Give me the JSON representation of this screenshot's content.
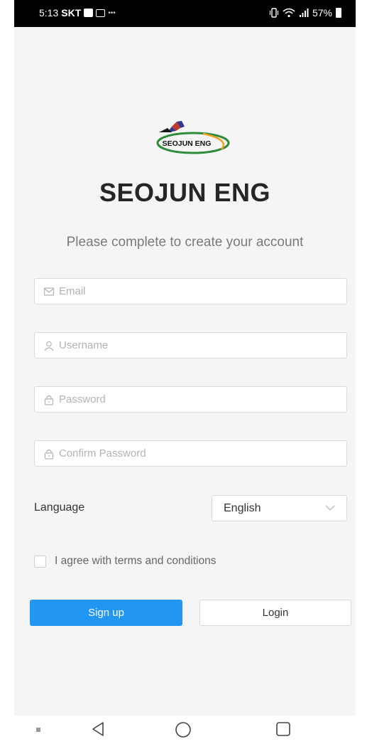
{
  "status_bar": {
    "time": "5:13",
    "carrier": "SKT",
    "battery": "57%"
  },
  "brand": {
    "logo_text": "SEOJUN ENG",
    "title": "SEOJUN ENG",
    "subtitle": "Please complete to create your account"
  },
  "form": {
    "email_placeholder": "Email",
    "username_placeholder": "Username",
    "password_placeholder": "Password",
    "confirm_password_placeholder": "Confirm Password",
    "language_label": "Language",
    "language_value": "English",
    "agree_label": "I agree with terms and conditions",
    "agree_checked": false
  },
  "actions": {
    "signup_label": "Sign up",
    "login_label": "Login"
  },
  "colors": {
    "primary": "#2196f3",
    "background": "#f5f5f5"
  },
  "icons": {
    "email": "mail-icon",
    "username": "user-icon",
    "password": "lock-icon",
    "confirm_password": "lock-icon",
    "language": "chevron-down-icon"
  }
}
